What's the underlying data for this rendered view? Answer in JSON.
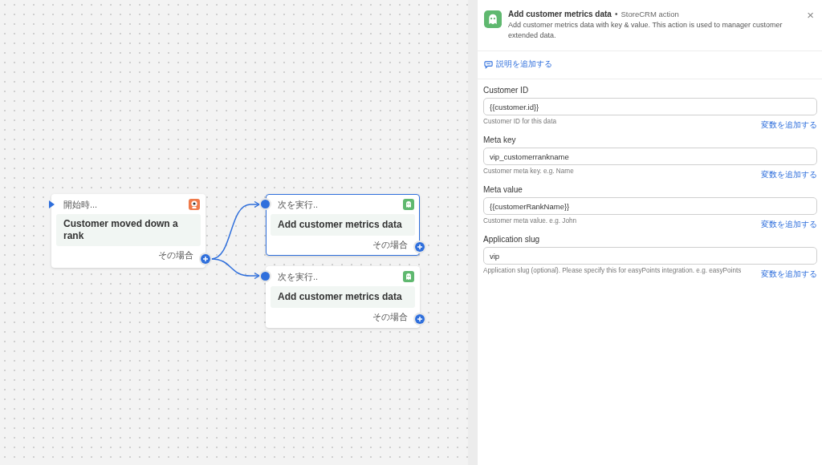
{
  "canvas": {
    "trigger": {
      "label": "開始時...",
      "title": "Customer moved down a rank",
      "branch": "その場合"
    },
    "actions": [
      {
        "label": "次を実行..",
        "title": "Add customer metrics data",
        "branch": "その場合",
        "selected": true
      },
      {
        "label": "次を実行..",
        "title": "Add customer metrics data",
        "branch": "その場合",
        "selected": false
      }
    ]
  },
  "panel": {
    "title": "Add customer metrics data",
    "separator": "•",
    "subtitle": "StoreCRM action",
    "description": "Add customer metrics data with key & value. This action is used to manager customer extended data.",
    "close": "×",
    "add_description": "説明を追加する",
    "fields": [
      {
        "label": "Customer ID",
        "value": "{{customer.id}}",
        "help": "Customer ID for this data",
        "link": "変数を追加する"
      },
      {
        "label": "Meta key",
        "value": "vip_customerrankname",
        "help": "Customer meta key. e.g. Name",
        "link": "変数を追加する"
      },
      {
        "label": "Meta value",
        "value": "{{customerRankName}}",
        "help": "Customer meta value. e.g. John",
        "link": "変数を追加する"
      },
      {
        "label": "Application slug",
        "value": "vip",
        "help": "Application slug (optional). Please specify this for easyPoints integration. e.g. easyPoints",
        "link": "変数を追加する"
      }
    ]
  }
}
